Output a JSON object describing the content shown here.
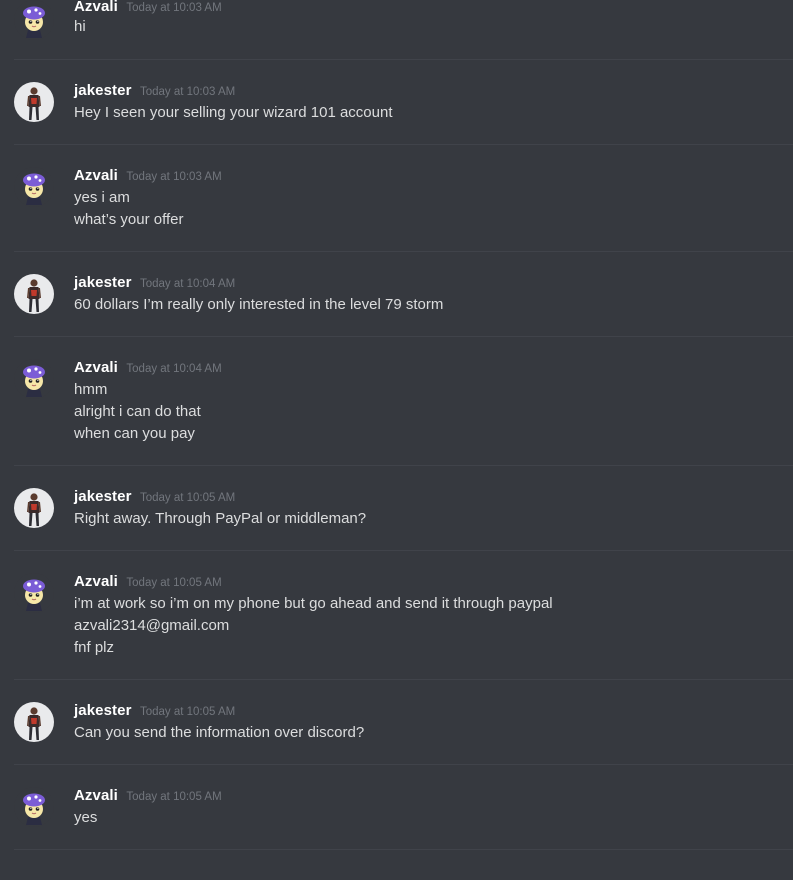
{
  "colors": {
    "background": "#36393f",
    "username": "#ffffff",
    "timestamp": "#72767d",
    "message_text": "#dcddde",
    "divider": "#40434a"
  },
  "messages": [
    {
      "author": "Azvali",
      "avatar": "purple-hat-character-icon",
      "timestamp": "Today at 10:03 AM",
      "lines": [
        "hi"
      ]
    },
    {
      "author": "jakester",
      "avatar": "person-photo-icon",
      "timestamp": "Today at 10:03 AM",
      "lines": [
        "Hey I seen your selling your wizard 101 account"
      ]
    },
    {
      "author": "Azvali",
      "avatar": "purple-hat-character-icon",
      "timestamp": "Today at 10:03 AM",
      "lines": [
        "yes i am",
        "what’s your offer"
      ]
    },
    {
      "author": "jakester",
      "avatar": "person-photo-icon",
      "timestamp": "Today at 10:04 AM",
      "lines": [
        "60 dollars I’m really only interested in the level 79 storm"
      ]
    },
    {
      "author": "Azvali",
      "avatar": "purple-hat-character-icon",
      "timestamp": "Today at 10:04 AM",
      "lines": [
        "hmm",
        "alright i can do that",
        "when can you pay"
      ]
    },
    {
      "author": "jakester",
      "avatar": "person-photo-icon",
      "timestamp": "Today at 10:05 AM",
      "lines": [
        "Right away. Through PayPal or middleman?"
      ]
    },
    {
      "author": "Azvali",
      "avatar": "purple-hat-character-icon",
      "timestamp": "Today at 10:05 AM",
      "lines": [
        "i’m at work so i’m on my phone but go ahead and send it through paypal",
        "azvali2314@gmail.com",
        "fnf plz"
      ]
    },
    {
      "author": "jakester",
      "avatar": "person-photo-icon",
      "timestamp": "Today at 10:05 AM",
      "lines": [
        "Can you send the information over discord?"
      ]
    },
    {
      "author": "Azvali",
      "avatar": "purple-hat-character-icon",
      "timestamp": "Today at 10:05 AM",
      "lines": [
        "yes"
      ]
    }
  ]
}
